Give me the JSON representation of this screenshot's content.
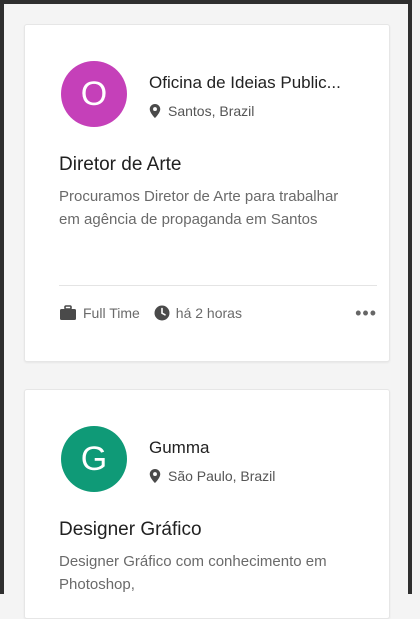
{
  "jobs": [
    {
      "avatar_letter": "O",
      "avatar_color": "#c540b9",
      "company": "Oficina de Ideias Public...",
      "location": "Santos, Brazil",
      "title": "Diretor de Arte",
      "description": "Procuramos Diretor de Arte para trabalhar em agência de propaganda em Santos",
      "job_type": "Full Time",
      "posted": "há 2 horas",
      "more_label": "•••"
    },
    {
      "avatar_letter": "G",
      "avatar_color": "#0f9a77",
      "company": "Gumma",
      "location": "São Paulo, Brazil",
      "title": "Designer Gráfico",
      "description": "Designer Gráfico com conhecimento em Photoshop,"
    }
  ]
}
